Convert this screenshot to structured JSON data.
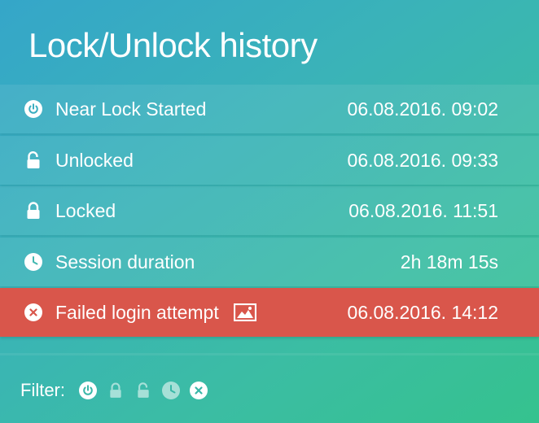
{
  "title": "Lock/Unlock history",
  "history": [
    {
      "icon": "power-icon",
      "label": "Near Lock Started",
      "value": "06.08.2016. 09:02"
    },
    {
      "icon": "unlock-icon",
      "label": "Unlocked",
      "value": "06.08.2016. 09:33"
    },
    {
      "icon": "lock-icon",
      "label": "Locked",
      "value": "06.08.2016. 11:51"
    },
    {
      "icon": "clock-icon",
      "label": "Session duration",
      "value": "2h 18m 15s"
    },
    {
      "icon": "close-circle-icon",
      "label": "Failed login attempt",
      "value": "06.08.2016. 14:12",
      "extra_icon": "image-icon"
    }
  ],
  "filter": {
    "label": "Filter:",
    "options": [
      "power-icon",
      "lock-icon",
      "unlock-icon",
      "clock-icon",
      "close-circle-icon"
    ]
  },
  "colors": {
    "background_start": "#35a6c9",
    "background_end": "#35c28e",
    "failed_row": "#d9564b",
    "text": "#ffffff"
  }
}
